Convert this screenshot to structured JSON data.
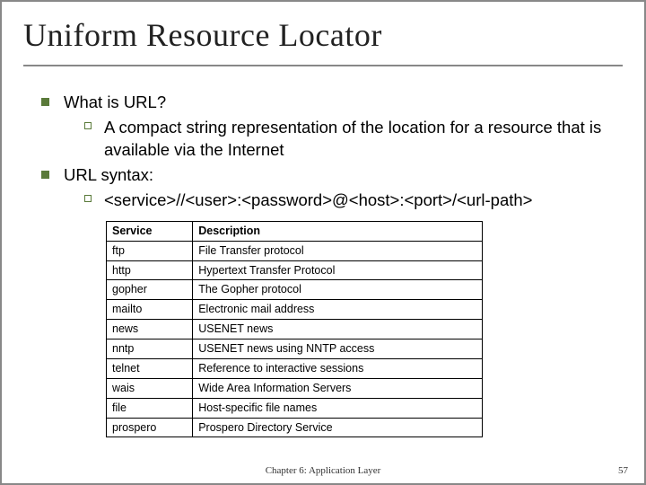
{
  "title": "Uniform Resource Locator",
  "bullets": {
    "b1": "What is URL?",
    "b1a": "A compact string representation of the location for a resource that is available via the Internet",
    "b2": "URL syntax:",
    "b2a": "<service>//<user>:<password>@<host>:<port>/<url-path>"
  },
  "table": {
    "headers": {
      "c0": "Service",
      "c1": "Description"
    },
    "rows": [
      {
        "c0": "ftp",
        "c1": "File Transfer protocol"
      },
      {
        "c0": "http",
        "c1": "Hypertext Transfer Protocol"
      },
      {
        "c0": "gopher",
        "c1": "The Gopher protocol"
      },
      {
        "c0": "mailto",
        "c1": "Electronic mail address"
      },
      {
        "c0": "news",
        "c1": "USENET news"
      },
      {
        "c0": "nntp",
        "c1": "USENET news using NNTP access"
      },
      {
        "c0": "telnet",
        "c1": "Reference to interactive sessions"
      },
      {
        "c0": "wais",
        "c1": "Wide Area Information Servers"
      },
      {
        "c0": "file",
        "c1": "Host-specific file names"
      },
      {
        "c0": "prospero",
        "c1": "Prospero Directory Service"
      }
    ]
  },
  "footer": "Chapter 6: Application Layer",
  "page": "57"
}
